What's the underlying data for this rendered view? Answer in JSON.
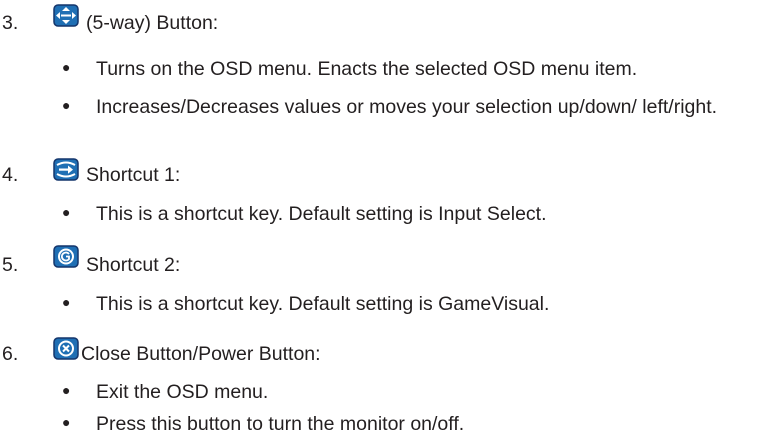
{
  "items": [
    {
      "number": "3.",
      "icon": "five-way-button-icon",
      "label": "(5-way) Button:",
      "bullets": [
        "Turns on the OSD menu. Enacts the selected OSD menu item.",
        "Increases/Decreases values or moves your selection up/down/ left/right."
      ]
    },
    {
      "number": "4.",
      "icon": "input-arrow-icon",
      "label": "Shortcut 1:",
      "bullets": [
        "This is a shortcut key. Default setting is Input Select."
      ]
    },
    {
      "number": "5.",
      "icon": "gamevisual-icon",
      "label": "Shortcut 2:",
      "bullets": [
        "This is a shortcut key. Default setting is GameVisual."
      ]
    },
    {
      "number": "6.",
      "icon": "close-x-icon",
      "label": "Close Button/Power Button:",
      "bullets": [
        "Exit the OSD menu.",
        "Press this button to turn the monitor on/off."
      ]
    }
  ],
  "colors": {
    "text": "#231f20",
    "icon_blue": "#1f6fb4",
    "icon_dark": "#14356b"
  }
}
